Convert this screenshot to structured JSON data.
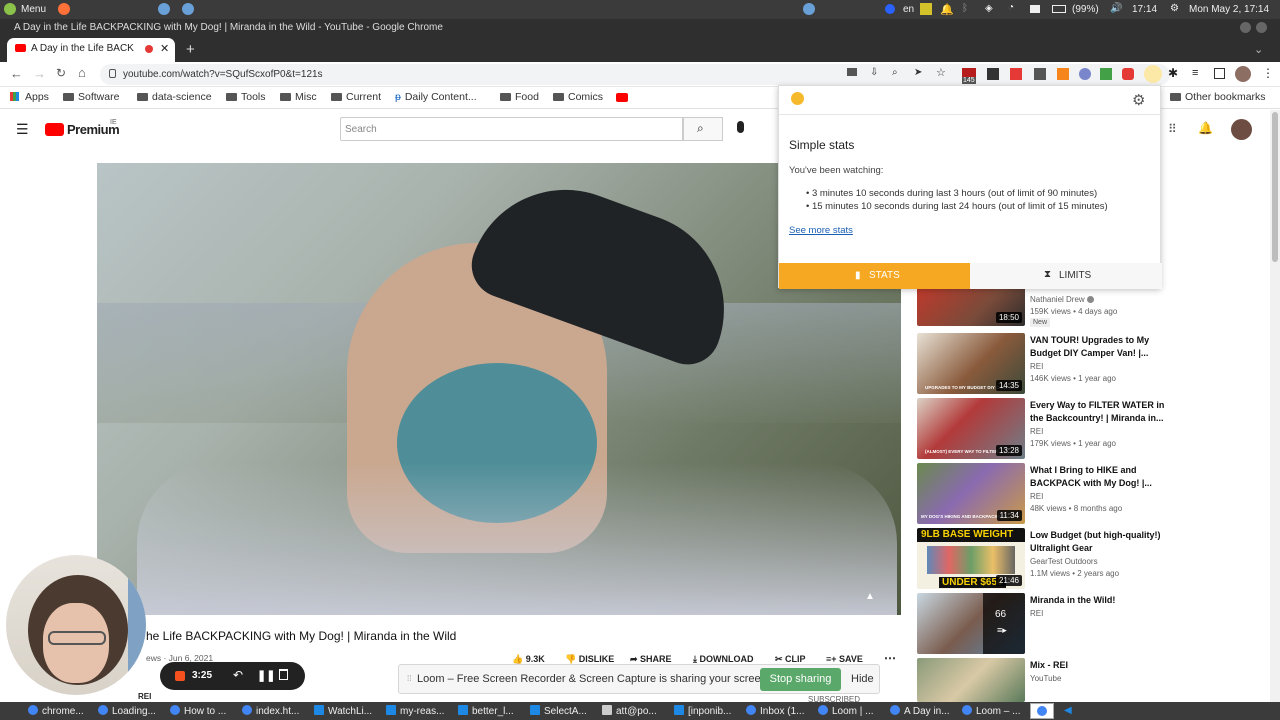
{
  "os_top": {
    "menu_label": "Menu",
    "lang": "en",
    "battery": "(99%)",
    "clock": "17:14",
    "datetime": "Mon May  2, 17:14"
  },
  "window": {
    "title": "A Day in the Life BACKPACKING with My Dog! | Miranda in the Wild - YouTube - Google Chrome"
  },
  "tab": {
    "title": "A Day in the Life BACK"
  },
  "address": {
    "url": "youtube.com/watch?v=SQufScxofP0&t=121s",
    "ext_badge": "145"
  },
  "bookmarks": {
    "items": [
      "Apps",
      "Software",
      "data-science",
      "Tools",
      "Misc",
      "Current",
      "Daily Content...",
      "Food",
      "Comics"
    ],
    "other": "Other bookmarks"
  },
  "yt": {
    "logo_text": "Premium",
    "region": "IE",
    "search_placeholder": "Search",
    "video_title": "he Life BACKPACKING with My Dog! | Miranda in the Wild",
    "video_meta": "ews · Jun 6, 2021",
    "channel": "REI",
    "actions": {
      "like": "9.3K",
      "dislike": "DISLIKE",
      "share": "SHARE",
      "download": "DOWNLOAD",
      "clip": "CLIP",
      "save": "SAVE"
    },
    "subscribed": "SUBSCRIBED"
  },
  "recorder": {
    "time": "3:25"
  },
  "loom": {
    "message": "Loom – Free Screen Recorder & Screen Capture is sharing your screen.",
    "stop": "Stop sharing",
    "hide": "Hide"
  },
  "popup": {
    "heading": "Simple stats",
    "watching": "You've been watching:",
    "stats": [
      "3 minutes 10 seconds during last 3 hours (out of limit of 90 minutes)",
      "15 minutes 10 seconds during last 24 hours (out of limit of 15 minutes)"
    ],
    "link": "See more stats",
    "tab_stats": "STATS",
    "tab_limits": "LIMITS"
  },
  "sidebar": [
    {
      "title": "",
      "channel": "Nathaniel Drew",
      "meta": "159K views • 4 days ago",
      "badge": "New",
      "duration": "18:50"
    },
    {
      "title": "VAN TOUR! Upgrades to My Budget DIY Camper Van! |...",
      "channel": "REI",
      "meta": "146K views • 1 year ago",
      "duration": "14:35",
      "thumb_caption": "UPGRADES TO MY BUDGET DIY CAMPER"
    },
    {
      "title": "Every Way to FILTER WATER in the Backcountry! | Miranda in...",
      "channel": "REI",
      "meta": "179K views • 1 year ago",
      "duration": "13:28",
      "thumb_caption": "(ALMOST) EVERY WAY TO FILTER"
    },
    {
      "title": "What I Bring to HIKE and BACKPACK with My Dog! |...",
      "channel": "REI",
      "meta": "48K views • 8 months ago",
      "duration": "11:34",
      "thumb_caption": "MY DOG'S HIKING AND BACKPACKING"
    },
    {
      "title": "Low Budget (but high-quality!) Ultralight Gear",
      "channel": "GearTest Outdoors",
      "meta": "1.1M views • 2 years ago",
      "duration": "21:46",
      "thumb_top": "9LB BASE WEIGHT",
      "thumb_bottom": "UNDER $650"
    },
    {
      "title": "Miranda in the Wild!",
      "channel": "REI",
      "meta": "",
      "duration": "",
      "count": "66"
    },
    {
      "title": "Mix - REI",
      "channel": "YouTube",
      "meta": "",
      "duration": ""
    }
  ],
  "taskbar": [
    "chrome...",
    "Loading...",
    "How to ...",
    "index.ht...",
    "WatchLi...",
    "my-reas...",
    "better_l...",
    "SelectA...",
    "att@po...",
    "[inponib...",
    "Inbox (1...",
    "Loom | ...",
    "A Day in...",
    "Loom – ..."
  ]
}
